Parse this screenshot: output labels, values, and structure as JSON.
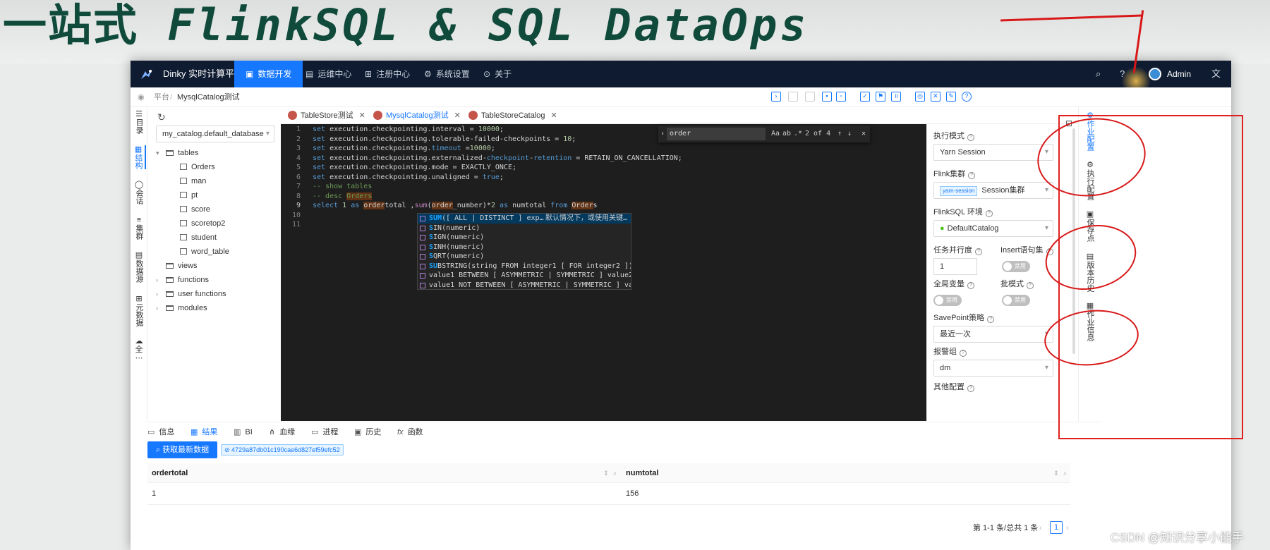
{
  "banner": {
    "prefix": "一站式",
    "title": "FlinkSQL & SQL DataOps"
  },
  "app": {
    "name": "Dinky 实时计算平台",
    "admin": "Admin"
  },
  "nav": [
    "数据开发",
    "运维中心",
    "注册中心",
    "系统设置",
    "关于"
  ],
  "breadcrumb": {
    "root": "平台",
    "current": "MysqlCatalog测试"
  },
  "left_sidebar": [
    "目录",
    "结构",
    "会话",
    "集群",
    "数据源",
    "元数据",
    "全"
  ],
  "catalog": {
    "selected": "my_catalog.default_database"
  },
  "tree": {
    "tables": "tables",
    "table_items": [
      "Orders",
      "man",
      "pt",
      "score",
      "scoretop2",
      "student",
      "word_table"
    ],
    "views": "views",
    "functions": "functions",
    "user_functions": "user functions",
    "modules": "modules"
  },
  "tabs": [
    "TableStore测试",
    "MysqlCatalog测试",
    "TableStoreCatalog"
  ],
  "editor": {
    "line_numbers": [
      "1",
      "2",
      "3",
      "4",
      "5",
      "6",
      "7",
      "8",
      "9",
      "10",
      "11"
    ],
    "find": {
      "query": "order",
      "count": "2 of 4"
    },
    "suggestions": [
      {
        "m": "SUM",
        "rest": "([ ALL | DISTINCT ] exp…",
        "doc": "默认情况下，或使用关键…"
      },
      {
        "m": "S",
        "rest": "IN(numeric)"
      },
      {
        "m": "S",
        "rest": "IGN(numeric)"
      },
      {
        "m": "S",
        "rest": "INH(numeric)"
      },
      {
        "m": "S",
        "rest": "QRT(numeric)"
      },
      {
        "m": "SU",
        "rest": "BSTRING(string FROM integer1 [ FOR integer2 ])"
      },
      {
        "m": "",
        "rest": "value1 BETWEEN [ ASYMMETRIC | SYMMETRIC ] value2 …"
      },
      {
        "m": "",
        "rest": "value1 NOT BETWEEN [ ASYMMETRIC | SYMMETRIC ] val…"
      }
    ]
  },
  "config": {
    "exec_mode_label": "执行模式",
    "exec_mode": "Yarn Session",
    "cluster_label": "Flink集群",
    "cluster_tag": "yarn-session",
    "cluster": "Session集群",
    "env_label": "FlinkSQL 环境",
    "env": "DefaultCatalog",
    "parallel_label": "任务并行度",
    "parallel": "1",
    "insert_label": "Insert语句集",
    "insert_toggle": "禁用",
    "global_label": "全局变量",
    "global_toggle": "禁用",
    "batch_label": "批模式",
    "batch_toggle": "禁用",
    "savepoint_label": "SavePoint策略",
    "savepoint": "最近一次",
    "alert_label": "报警组",
    "alert": "dm",
    "other_label": "其他配置"
  },
  "right_sidebar": [
    "作业配置",
    "执行配置",
    "保存点",
    "版本历史",
    "作业信息"
  ],
  "bottom_tabs": [
    "信息",
    "结果",
    "BI",
    "血缘",
    "进程",
    "历史",
    "函数"
  ],
  "result": {
    "refresh_button": "获取最新数据",
    "job_id": "4729a87db01c190cae6d827ef59efc52",
    "columns": [
      "ordertotal",
      "numtotal"
    ],
    "rows": [
      [
        "1",
        "156"
      ]
    ],
    "pagination": "第 1-1 条/总共 1 条",
    "page": "1"
  },
  "watermark": "CSDN @知识分享小能手",
  "colors": {
    "nav_bg": "#0e1b30",
    "accent": "#1677ff",
    "banner": "#0f4a3a",
    "annotation": "#e02020",
    "editor_bg": "#1e1e1e"
  }
}
